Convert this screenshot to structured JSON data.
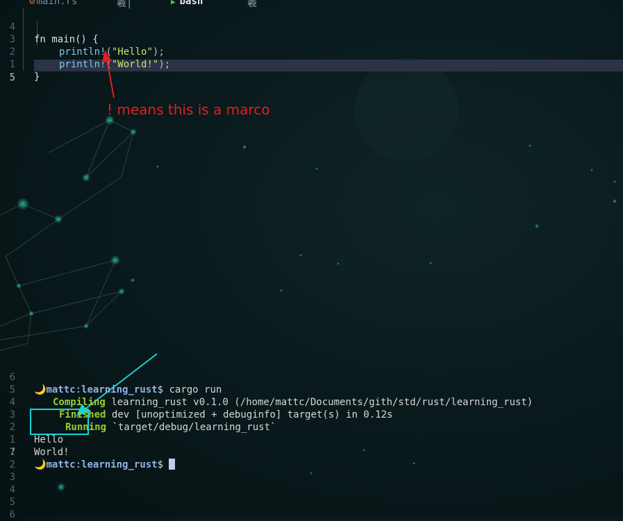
{
  "tabs": [
    {
      "label": "main.rs",
      "icon": "rust-file-icon"
    },
    {
      "label": "羲|"
    },
    {
      "label": "bash",
      "icon": "terminal-icon"
    },
    {
      "label": "羲"
    }
  ],
  "editor": {
    "lines": [
      {
        "number": "4",
        "code": [
          "fn",
          " main() {"
        ]
      },
      {
        "number": "3",
        "code": [
          "println!",
          "(",
          "\"Hello\"",
          ");"
        ]
      },
      {
        "number": "2",
        "code": [
          "println!",
          "(",
          "\"World!\"",
          ");"
        ]
      },
      {
        "number": "1",
        "code": [
          "}"
        ]
      },
      {
        "number": "5",
        "code": []
      }
    ]
  },
  "annotation": "! means this is a marco",
  "terminal": {
    "prompt": {
      "moon": "🌙",
      "user": "mattc",
      "colon": ":",
      "path": "learning_rust",
      "dollar": "$ "
    },
    "lines": [
      {
        "number": "6",
        "command": "cargo run"
      },
      {
        "number": "5",
        "status": "Compiling",
        "text": " learning_rust v0.1.0 (/home/mattc/Documents/gith/std/rust/learning_rust)"
      },
      {
        "number": "4",
        "status": "Finished",
        "text": " dev [unoptimized + debuginfo] target(s) in 0.12s"
      },
      {
        "number": "3",
        "status": "Running",
        "text": " `target/debug/learning_rust`"
      },
      {
        "number": "2",
        "text": "Hello"
      },
      {
        "number": "1",
        "text": "World!"
      },
      {
        "number": "7"
      },
      {
        "number": "1"
      },
      {
        "number": "2"
      },
      {
        "number": "3"
      },
      {
        "number": "4"
      },
      {
        "number": "5"
      },
      {
        "number": "6"
      }
    ]
  },
  "colors": {
    "annotation": "#e02020",
    "highlight_box": "#19d4d4",
    "status_green": "#9acd32",
    "prompt_blue": "#8fb4e8"
  }
}
